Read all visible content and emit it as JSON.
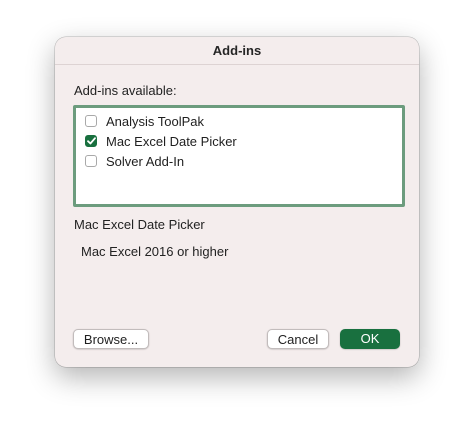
{
  "dialog": {
    "title": "Add-ins",
    "section_label": "Add-ins available:",
    "addins": [
      {
        "label": "Analysis ToolPak",
        "checked": false
      },
      {
        "label": "Mac Excel Date Picker",
        "checked": true
      },
      {
        "label": "Solver Add-In",
        "checked": false
      }
    ],
    "selected_name": "Mac Excel Date Picker",
    "selected_description": "Mac Excel 2016 or higher",
    "buttons": {
      "browse": "Browse...",
      "cancel": "Cancel",
      "ok": "OK"
    },
    "colors": {
      "accent": "#19703f",
      "list_focus_border": "#6c9c7e",
      "dialog_background": "#f4eded"
    }
  }
}
